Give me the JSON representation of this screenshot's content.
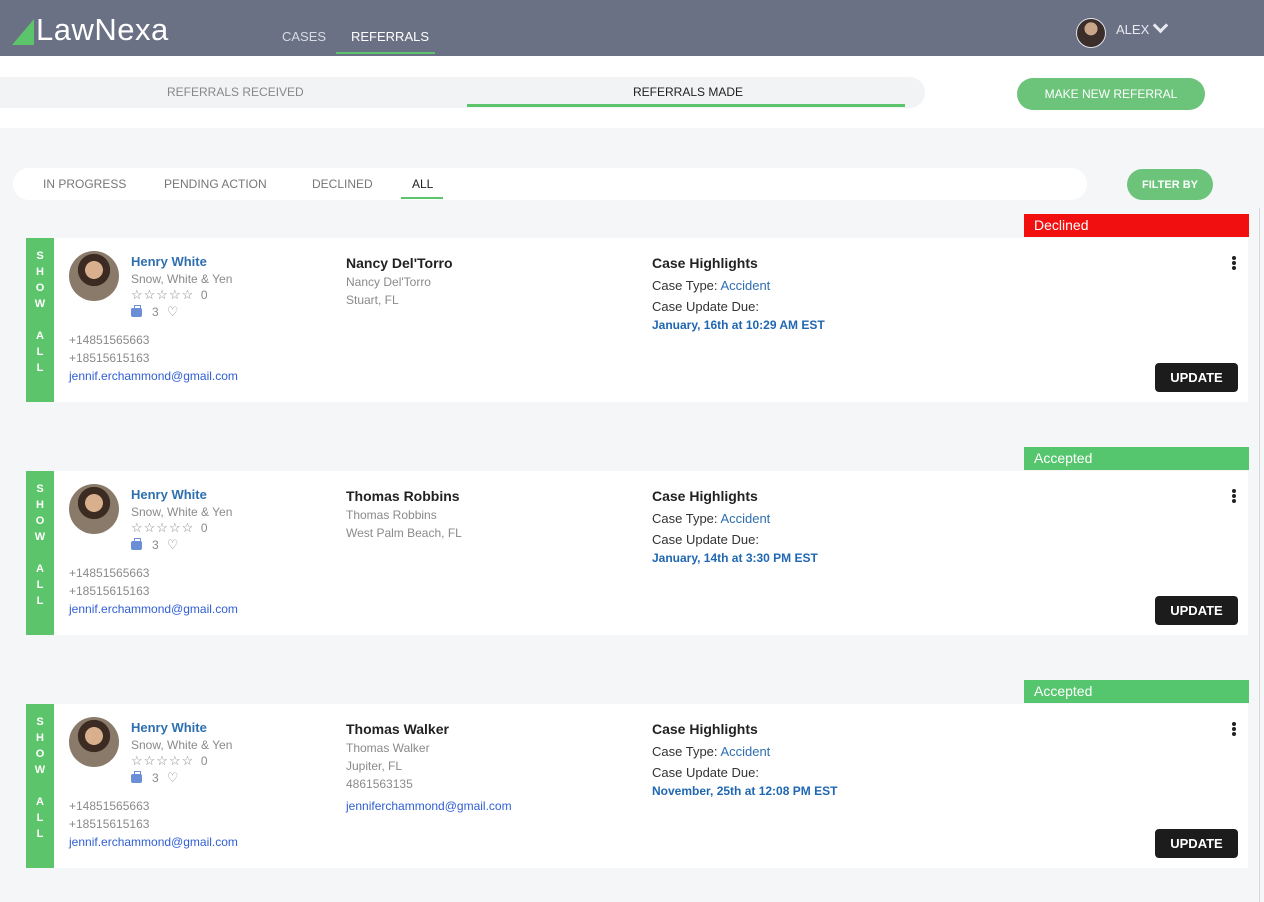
{
  "header": {
    "logo": "LawNexa",
    "nav": [
      "CASES",
      "REFERRALS"
    ],
    "user": "ALEX"
  },
  "subtabs": {
    "received": "REFERRALS RECEIVED",
    "made": "REFERRALS MADE",
    "new_button": "MAKE NEW REFERRAL"
  },
  "filters": {
    "tabs": [
      "IN PROGRESS",
      "PENDING ACTION",
      "DECLINED",
      "ALL"
    ],
    "active": "ALL",
    "filter_button": "FILTER BY"
  },
  "colors": {
    "header_bg": "#6b7184",
    "accent_green": "#5cc46a",
    "declined_red": "#f20f0f",
    "accepted_green": "#56c66e"
  },
  "referrals": [
    {
      "status": "Declined",
      "show_all": [
        "S",
        "H",
        "O",
        "W",
        "A",
        "L",
        "L"
      ],
      "lawyer": {
        "name": "Henry White",
        "firm": "Snow, White & Yen",
        "stars": "☆☆☆☆☆",
        "rating": "0",
        "cases": "3",
        "phone1": "+14851565663",
        "phone2": "+18515615163",
        "email": "jennif.erchammond@gmail.com"
      },
      "client": {
        "name": "Nancy Del'Torro",
        "sub": "Nancy Del'Torro",
        "city": "Stuart, FL",
        "phone": "",
        "email": ""
      },
      "highlights": {
        "title": "Case Highlights",
        "type_label": "Case Type:",
        "type_value": "Accident",
        "due_label": "Case Update Due:",
        "due_date": "January, 16th at 10:29 AM EST"
      },
      "update_label": "UPDATE"
    },
    {
      "status": "Accepted",
      "show_all": [
        "S",
        "H",
        "O",
        "W",
        "A",
        "L",
        "L"
      ],
      "lawyer": {
        "name": "Henry White",
        "firm": "Snow, White & Yen",
        "stars": "☆☆☆☆☆",
        "rating": "0",
        "cases": "3",
        "phone1": "+14851565663",
        "phone2": "+18515615163",
        "email": "jennif.erchammond@gmail.com"
      },
      "client": {
        "name": "Thomas Robbins",
        "sub": "Thomas Robbins",
        "city": "West Palm Beach, FL",
        "phone": "",
        "email": ""
      },
      "highlights": {
        "title": "Case Highlights",
        "type_label": "Case Type:",
        "type_value": "Accident",
        "due_label": "Case Update Due:",
        "due_date": "January, 14th at 3:30 PM EST"
      },
      "update_label": "UPDATE"
    },
    {
      "status": "Accepted",
      "show_all": [
        "S",
        "H",
        "O",
        "W",
        "A",
        "L",
        "L"
      ],
      "lawyer": {
        "name": "Henry White",
        "firm": "Snow, White & Yen",
        "stars": "☆☆☆☆☆",
        "rating": "0",
        "cases": "3",
        "phone1": "+14851565663",
        "phone2": "+18515615163",
        "email": "jennif.erchammond@gmail.com"
      },
      "client": {
        "name": "Thomas Walker",
        "sub": "Thomas Walker",
        "city": "Jupiter, FL",
        "phone": "4861563135",
        "email": "jenniferchammond@gmail.com"
      },
      "highlights": {
        "title": "Case Highlights",
        "type_label": "Case Type:",
        "type_value": "Accident",
        "due_label": "Case Update Due:",
        "due_date": "November, 25th at 12:08 PM EST"
      },
      "update_label": "UPDATE"
    }
  ]
}
